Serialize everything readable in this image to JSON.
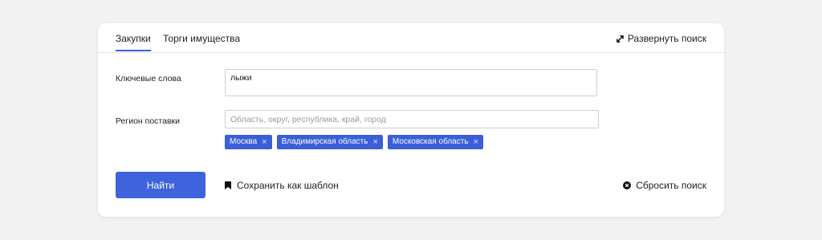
{
  "tabs": [
    {
      "label": "Закупки",
      "active": true
    },
    {
      "label": "Торги имущества",
      "active": false
    }
  ],
  "expand_label": "Развернуть поиск",
  "keywords": {
    "label": "Ключевые слова",
    "value": "лыжи"
  },
  "region": {
    "label": "Регион поставки",
    "placeholder": "Область, округ, республика, край, город",
    "chips": [
      {
        "label": "Москва",
        "remove": "×"
      },
      {
        "label": "Владимирская область",
        "remove": "×"
      },
      {
        "label": "Московская область",
        "remove": "×"
      }
    ]
  },
  "actions": {
    "find_label": "Найти",
    "save_template_label": "Сохранить как шаблон",
    "reset_label": "Сбросить поиск"
  },
  "colors": {
    "accent": "#3e63dd",
    "chip": "#3a5fd9",
    "background": "#f2f2f2"
  }
}
